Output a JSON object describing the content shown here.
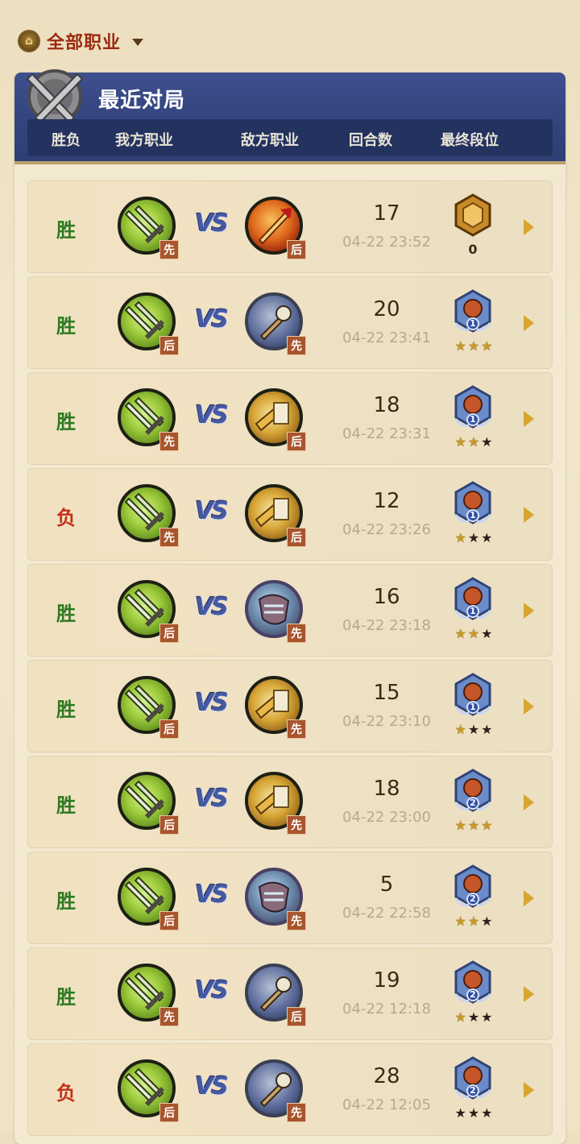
{
  "filter": {
    "label": "全部职业",
    "logo_icon": "hearthstone-logo-icon"
  },
  "header": {
    "title": "最近对局",
    "columns": [
      "胜负",
      "我方职业",
      "敌方职业",
      "回合数",
      "最终段位"
    ]
  },
  "vs_label": "VS",
  "rows": [
    {
      "result": "胜",
      "result_type": "win",
      "my_order": "先",
      "enemy_class": "warlock",
      "enemy_order": "后",
      "turns": "17",
      "time": "04-22 23:52",
      "rank_type": "legend",
      "rank_value": "0",
      "stars_lit": 0
    },
    {
      "result": "胜",
      "result_type": "win",
      "my_order": "后",
      "enemy_class": "priest",
      "enemy_order": "先",
      "turns": "20",
      "time": "04-22 23:41",
      "rank_type": "diamond",
      "rank_value": "1",
      "stars_lit": 3
    },
    {
      "result": "胜",
      "result_type": "win",
      "my_order": "先",
      "enemy_class": "paladin",
      "enemy_order": "后",
      "turns": "18",
      "time": "04-22 23:31",
      "rank_type": "diamond",
      "rank_value": "1",
      "stars_lit": 2
    },
    {
      "result": "负",
      "result_type": "loss",
      "my_order": "先",
      "enemy_class": "paladin",
      "enemy_order": "后",
      "turns": "12",
      "time": "04-22 23:26",
      "rank_type": "diamond",
      "rank_value": "1",
      "stars_lit": 1
    },
    {
      "result": "胜",
      "result_type": "win",
      "my_order": "后",
      "enemy_class": "druid",
      "enemy_order": "先",
      "turns": "16",
      "time": "04-22 23:18",
      "rank_type": "diamond",
      "rank_value": "1",
      "stars_lit": 2
    },
    {
      "result": "胜",
      "result_type": "win",
      "my_order": "后",
      "enemy_class": "paladin",
      "enemy_order": "先",
      "turns": "15",
      "time": "04-22 23:10",
      "rank_type": "diamond",
      "rank_value": "1",
      "stars_lit": 1
    },
    {
      "result": "胜",
      "result_type": "win",
      "my_order": "后",
      "enemy_class": "paladin",
      "enemy_order": "先",
      "turns": "18",
      "time": "04-22 23:00",
      "rank_type": "diamond",
      "rank_value": "2",
      "stars_lit": 3
    },
    {
      "result": "胜",
      "result_type": "win",
      "my_order": "后",
      "enemy_class": "druid",
      "enemy_order": "先",
      "turns": "5",
      "time": "04-22 22:58",
      "rank_type": "diamond",
      "rank_value": "2",
      "stars_lit": 2
    },
    {
      "result": "胜",
      "result_type": "win",
      "my_order": "先",
      "enemy_class": "priest",
      "enemy_order": "后",
      "turns": "19",
      "time": "04-22 12:18",
      "rank_type": "diamond",
      "rank_value": "2",
      "stars_lit": 1
    },
    {
      "result": "负",
      "result_type": "loss",
      "my_order": "后",
      "enemy_class": "priest",
      "enemy_order": "先",
      "turns": "28",
      "time": "04-22 12:05",
      "rank_type": "diamond",
      "rank_value": "2",
      "stars_lit": 0
    }
  ]
}
